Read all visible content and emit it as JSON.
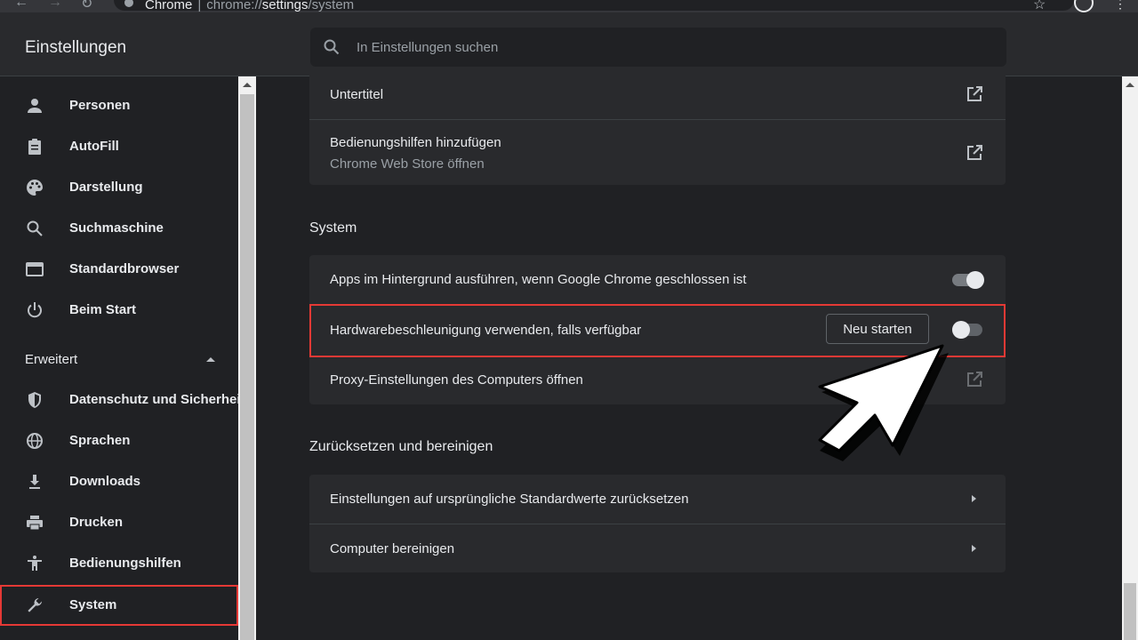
{
  "browser": {
    "tab_title": "Chrome",
    "url_prefix": "chrome://",
    "url_host": "settings",
    "url_path": "/system"
  },
  "header": {
    "title": "Einstellungen",
    "search_placeholder": "In Einstellungen suchen"
  },
  "sidebar": {
    "items": [
      {
        "label": "Personen",
        "icon": "person-icon"
      },
      {
        "label": "AutoFill",
        "icon": "clipboard-icon"
      },
      {
        "label": "Darstellung",
        "icon": "palette-icon"
      },
      {
        "label": "Suchmaschine",
        "icon": "search-icon"
      },
      {
        "label": "Standardbrowser",
        "icon": "browser-window-icon"
      },
      {
        "label": "Beim Start",
        "icon": "power-icon"
      }
    ],
    "advanced_label": "Erweitert",
    "advanced_items": [
      {
        "label": "Datenschutz und Sicherheit",
        "icon": "shield-icon"
      },
      {
        "label": "Sprachen",
        "icon": "globe-icon"
      },
      {
        "label": "Downloads",
        "icon": "download-icon"
      },
      {
        "label": "Drucken",
        "icon": "printer-icon"
      },
      {
        "label": "Bedienungshilfen",
        "icon": "accessibility-icon"
      },
      {
        "label": "System",
        "icon": "wrench-icon",
        "selected": true
      }
    ]
  },
  "accessibility_card": {
    "rows": [
      {
        "title": "Untertitel"
      },
      {
        "title": "Bedienungshilfen hinzufügen",
        "subtitle": "Chrome Web Store öffnen"
      }
    ]
  },
  "system": {
    "title": "System",
    "rows": [
      {
        "title": "Apps im Hintergrund ausführen, wenn Google Chrome geschlossen ist",
        "toggle": true
      },
      {
        "title": "Hardwarebeschleunigung verwenden, falls verfügbar",
        "button": "Neu starten",
        "toggle": false,
        "highlighted": true
      },
      {
        "title": "Proxy-Einstellungen des Computers öffnen"
      }
    ]
  },
  "reset": {
    "title": "Zurücksetzen und bereinigen",
    "rows": [
      {
        "title": "Einstellungen auf ursprüngliche Standardwerte zurücksetzen"
      },
      {
        "title": "Computer bereinigen"
      }
    ]
  },
  "colors": {
    "highlight": "#e53935",
    "background": "#202124",
    "card": "#292a2d"
  }
}
